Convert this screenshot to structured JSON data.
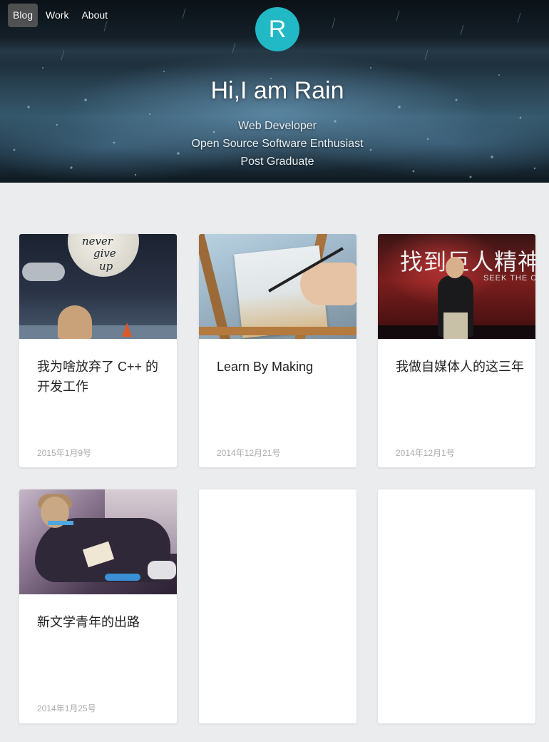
{
  "nav": {
    "items": [
      {
        "label": "Blog",
        "active": true
      },
      {
        "label": "Work",
        "active": false
      },
      {
        "label": "About",
        "active": false
      }
    ]
  },
  "hero": {
    "avatar_letter": "R",
    "avatar_color": "#21b9c5",
    "title": "Hi,I am Rain",
    "subtitles": [
      "Web Developer",
      "Open Source Software Enthusiast",
      "Post Graduate"
    ]
  },
  "posts": [
    {
      "title": "我为啥放弃了 C++ 的开发工作",
      "date": "2015年1月9号",
      "image_text": [
        "never",
        "give",
        "up"
      ]
    },
    {
      "title": "Learn By Making",
      "date": "2014年12月21号"
    },
    {
      "title": "我做自媒体人的这三年",
      "date": "2014年12月1号",
      "image_text": [
        "找到巨人精神",
        "SEEK THE C"
      ]
    },
    {
      "title": "新文学青年的出路",
      "date": "2014年1月25号"
    }
  ]
}
